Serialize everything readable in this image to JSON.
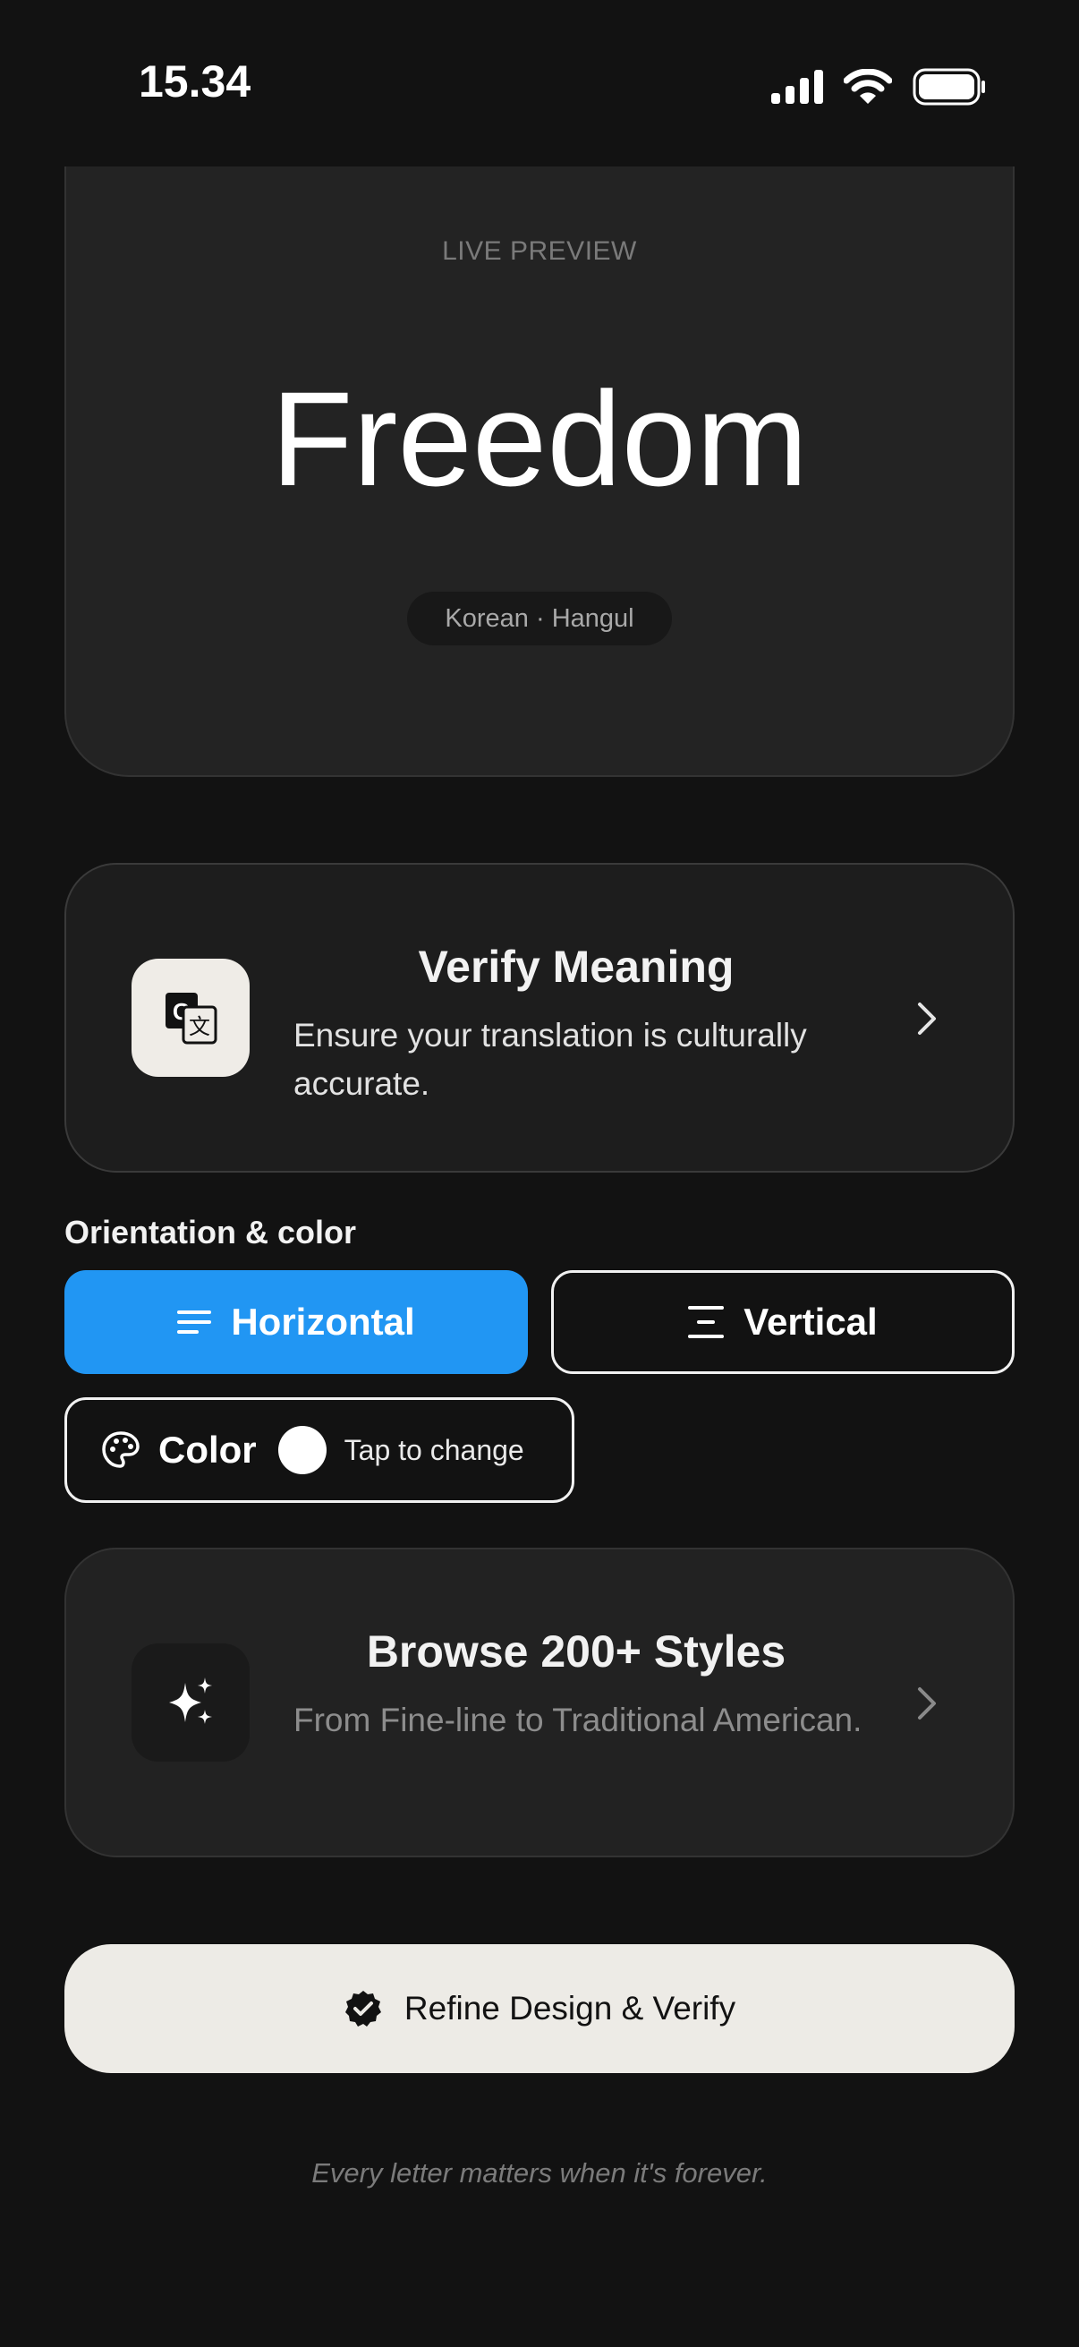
{
  "status_bar": {
    "time": "15.34"
  },
  "preview": {
    "label": "LIVE PREVIEW",
    "word": "Freedom",
    "language": "Korean · Hangul"
  },
  "verify_card": {
    "icon": "translate-icon",
    "title": "Verify Meaning",
    "subtitle": "Ensure your translation is culturally accurate."
  },
  "orientation": {
    "label": "Orientation & color",
    "options": [
      {
        "label": "Horizontal",
        "icon": "lines-icon",
        "selected": true
      },
      {
        "label": "Vertical",
        "icon": "vertical-align-icon",
        "selected": false
      }
    ],
    "color": {
      "label": "Color",
      "hint": "Tap to change",
      "swatch": "#ffffff",
      "icon": "palette-icon"
    }
  },
  "browse_card": {
    "icon": "sparkles-icon",
    "title": "Browse 200+ Styles",
    "subtitle": "From Fine-line to Traditional American."
  },
  "cta": {
    "label": "Refine Design & Verify",
    "icon": "verified-badge-icon"
  },
  "footer": {
    "note": "Every letter matters when it's forever."
  },
  "colors": {
    "accent": "#2196f3",
    "background": "#121212",
    "card": "#1d1d1d",
    "cta_bg": "#edebe6"
  }
}
